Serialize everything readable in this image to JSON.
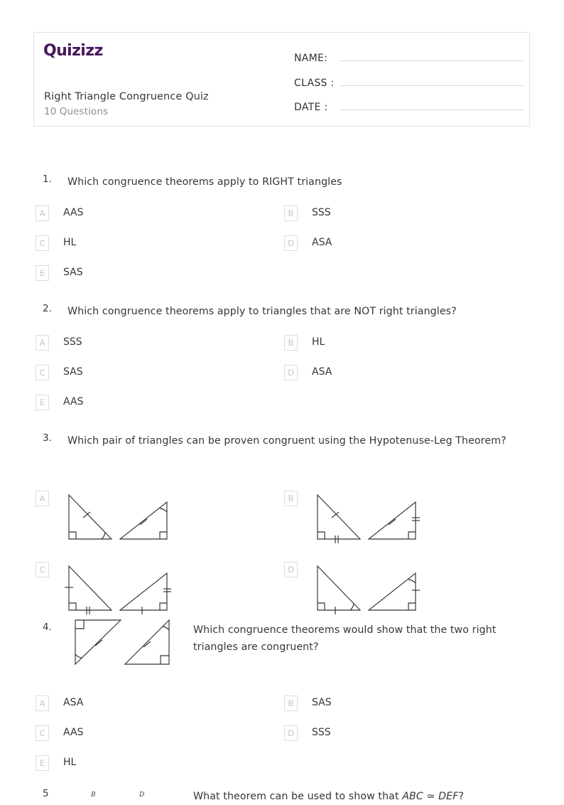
{
  "brand": {
    "name": "Quizizz"
  },
  "header": {
    "title": "Right Triangle Congruence Quiz",
    "question_count": "10 Questions",
    "fields": [
      {
        "label": "NAME:"
      },
      {
        "label": "CLASS :"
      },
      {
        "label": "DATE  :"
      }
    ]
  },
  "colors": {
    "brand_purple": "#46175c",
    "text": "#35363a",
    "muted": "#8d8f96",
    "letter_box_border": "#dededf",
    "letter_box_text": "#c5c6c9",
    "card_border": "#e2e2e4",
    "field_line": "#d8d9dc",
    "figure_stroke": "#2f3033"
  },
  "questions": [
    {
      "number": "1.",
      "text": "Which congruence theorems apply to RIGHT triangles",
      "option_type": "text",
      "options": [
        {
          "letter": "A",
          "label": "AAS"
        },
        {
          "letter": "B",
          "label": "SSS"
        },
        {
          "letter": "C",
          "label": "HL"
        },
        {
          "letter": "D",
          "label": "ASA"
        },
        {
          "letter": "E",
          "label": "SAS"
        }
      ]
    },
    {
      "number": "2.",
      "text": "Which congruence theorems apply to triangles that are NOT right triangles?",
      "option_type": "text",
      "options": [
        {
          "letter": "A",
          "label": "SSS"
        },
        {
          "letter": "B",
          "label": "HL"
        },
        {
          "letter": "C",
          "label": "SAS"
        },
        {
          "letter": "D",
          "label": "ASA"
        },
        {
          "letter": "E",
          "label": "AAS"
        }
      ]
    },
    {
      "number": "3.",
      "text": "Which pair of triangles can be proven congruent using the Hypotenuse-Leg Theorem?",
      "option_type": "figure",
      "options": [
        {
          "letter": "A",
          "figure": "pair-hyp-tick-angle"
        },
        {
          "letter": "B",
          "figure": "pair-hyp-tick-leg-double"
        },
        {
          "letter": "C",
          "figure": "pair-legs-single-double"
        },
        {
          "letter": "D",
          "figure": "pair-angle-leg-tick"
        }
      ]
    },
    {
      "number": "4.",
      "text": "Which congruence theorems would show that the two right triangles are congruent?",
      "inline_figure": "pair-diagonal-hyp-tick-angle",
      "option_type": "text",
      "options": [
        {
          "letter": "A",
          "label": "ASA"
        },
        {
          "letter": "B",
          "label": "SAS"
        },
        {
          "letter": "C",
          "label": "AAS"
        },
        {
          "letter": "D",
          "label": "SSS"
        },
        {
          "letter": "E",
          "label": "HL"
        }
      ]
    },
    {
      "number": "5",
      "text_plain_prefix": "What theorem can be used to show that ",
      "text_italic": "ABC ≃ DEF",
      "text_plain_suffix": "?",
      "vertex_labels": [
        "B",
        "D"
      ],
      "option_type": "figure-cut-off",
      "options": []
    }
  ]
}
